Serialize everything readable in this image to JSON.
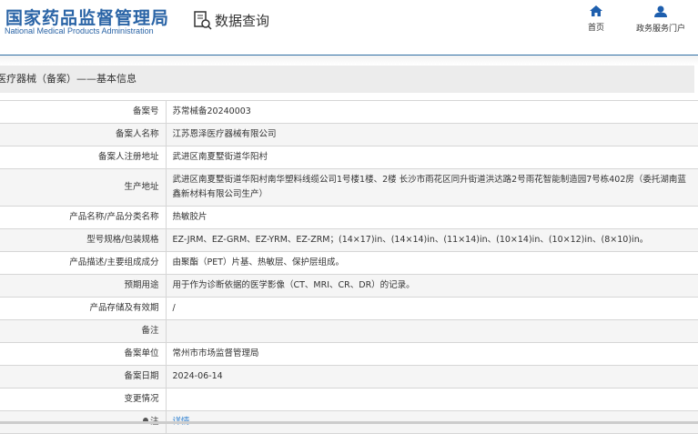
{
  "header": {
    "logo_cn": "国家药品监督管理局",
    "logo_en": "National Medical Products Administration",
    "query_label": "数据查询",
    "nav": [
      {
        "label": "首页",
        "icon": "home-icon"
      },
      {
        "label": "政务服务门户",
        "icon": "user-icon"
      }
    ]
  },
  "section_title": "医疗器械（备案）——基本信息",
  "rows": [
    {
      "label": "备案号",
      "value": "苏常械备20240003"
    },
    {
      "label": "备案人名称",
      "value": "江苏恩泽医疗器械有限公司"
    },
    {
      "label": "备案人注册地址",
      "value": "武进区南夏墅街道华阳村"
    },
    {
      "label": "生产地址",
      "value": "武进区南夏墅街道华阳村南华塑料线缆公司1号楼1楼、2楼 长沙市雨花区同升街道洪达路2号雨花智能制造园7号栋402房（委托湖南蓝鑫新材料有限公司生产）"
    },
    {
      "label": "产品名称/产品分类名称",
      "value": "热敏胶片"
    },
    {
      "label": "型号规格/包装规格",
      "value": "EZ-JRM、EZ-GRM、EZ-YRM、EZ-ZRM；(14×17)in、(14×14)in、(11×14)in、(10×14)in、(10×12)in、(8×10)in。"
    },
    {
      "label": "产品描述/主要组成成分",
      "value": "由聚酯（PET）片基、热敏层、保护层组成。"
    },
    {
      "label": "预期用途",
      "value": "用于作为诊断依据的医学影像（CT、MRI、CR、DR）的记录。"
    },
    {
      "label": "产品存储及有效期",
      "value": "/"
    },
    {
      "label": "备注",
      "value": ""
    },
    {
      "label": "备案单位",
      "value": "常州市市场监督管理局"
    },
    {
      "label": "备案日期",
      "value": "2024-06-14"
    },
    {
      "label": "变更情况",
      "value": ""
    }
  ],
  "note": {
    "label": "注",
    "link": "详情"
  }
}
